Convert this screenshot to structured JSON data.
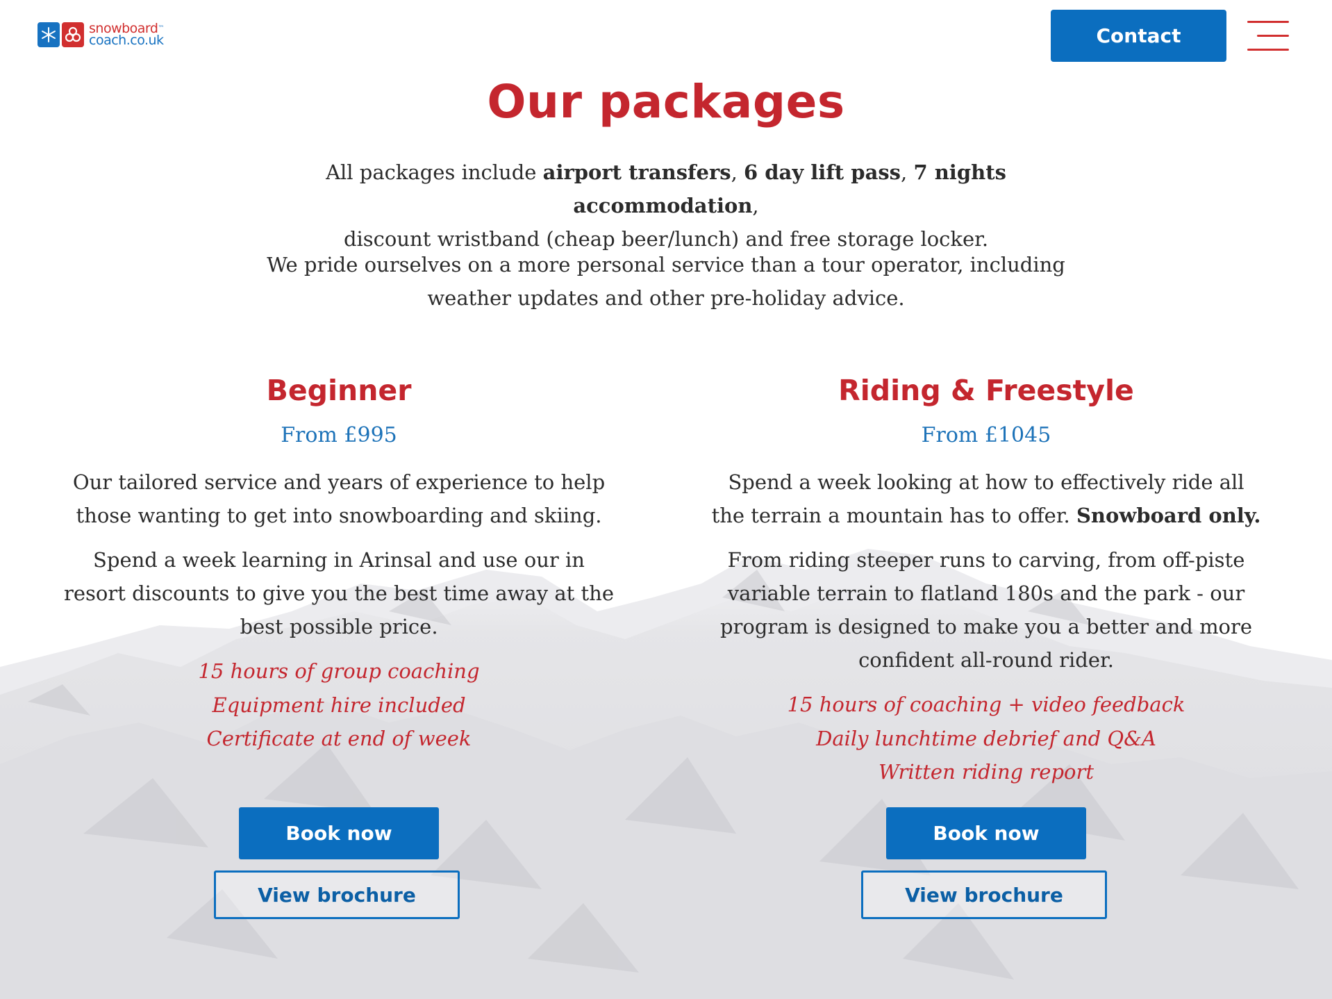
{
  "header": {
    "logo": {
      "line1": "snowboard",
      "line2": "coach.co.uk",
      "trademark": "™"
    },
    "contact_label": "Contact"
  },
  "main": {
    "title": "Our packages",
    "intro": {
      "p1_a": "All packages include ",
      "p1_b1": "airport transfers",
      "p1_sep1": ", ",
      "p1_b2": "6 day lift pass",
      "p1_sep2": ", ",
      "p1_b3": "7 nights accommodation",
      "p1_end": ",",
      "p1_line2": "discount wristband (cheap beer/lunch) and free storage locker.",
      "p2_line1": "We pride ourselves on a more personal service than a tour operator, including",
      "p2_line2": "weather updates and other pre-holiday advice."
    },
    "packages": [
      {
        "title": "Beginner",
        "price": "From £995",
        "desc1_line1": "Our tailored service and years of experience to help",
        "desc1_line2": "those wanting to get into snowboarding and skiing.",
        "desc2_line1": "Spend a week learning in Arinsal and use our in",
        "desc2_line2": "resort discounts to give you the best time away at the",
        "desc2_line3": "best possible price.",
        "features": [
          "15 hours of group coaching",
          "Equipment hire included",
          "Certificate at end of week"
        ],
        "book_label": "Book now",
        "brochure_label": "View brochure"
      },
      {
        "title": "Riding & Freestyle",
        "price": "From £1045",
        "desc1_line1": "Spend a week looking at how to effectively ride all",
        "desc1_line2_a": "the terrain a mountain has to offer. ",
        "desc1_line2_b": "Snowboard only.",
        "desc2_line1": "From riding steeper runs to carving, from off-piste",
        "desc2_line2": "variable terrain to flatland 180s and the park - our",
        "desc2_line3": "program is designed to make you a better and more",
        "desc2_line4": "confident all-round rider.",
        "features": [
          "15 hours of coaching + video feedback",
          "Daily lunchtime debrief and Q&A",
          "Written riding report"
        ],
        "book_label": "Book now",
        "brochure_label": "View brochure"
      }
    ]
  },
  "colors": {
    "brand_red": "#c4262e",
    "brand_blue": "#0b6ebf",
    "price_blue": "#1c72b8",
    "text": "#2b2b2b"
  }
}
